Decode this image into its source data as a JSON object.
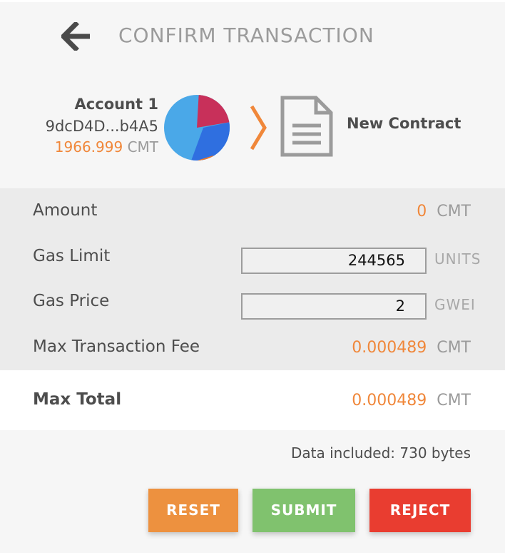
{
  "header": {
    "title": "CONFIRM TRANSACTION",
    "back_icon": "arrow-left-icon"
  },
  "from_account": {
    "name": "Account 1",
    "address": "9dcD4D...b4A5",
    "balance": "1966.999",
    "currency": "CMT",
    "avatar_icon": "identicon-pie"
  },
  "recipient": {
    "arrow_icon": "chevron-right-icon",
    "icon": "document-icon",
    "label": "New Contract"
  },
  "details": {
    "amount": {
      "label": "Amount",
      "value": "0",
      "unit": "CMT"
    },
    "gas_limit": {
      "label": "Gas Limit",
      "value": "244565",
      "unit": "UNITS"
    },
    "gas_price": {
      "label": "Gas Price",
      "value": "2",
      "unit": "GWEI"
    },
    "max_fee": {
      "label": "Max Transaction Fee",
      "value": "0.000489",
      "unit": "CMT"
    }
  },
  "total": {
    "label": "Max Total",
    "value": "0.000489",
    "unit": "CMT"
  },
  "data_included": "Data included: 730 bytes",
  "buttons": {
    "reset": "RESET",
    "submit": "SUBMIT",
    "reject": "REJECT"
  },
  "colors": {
    "accent_orange": "#f0873a",
    "reset_button": "#ed913f",
    "submit_button": "#80c26e",
    "reject_button": "#e93d30",
    "details_background": "#ebebeb"
  }
}
